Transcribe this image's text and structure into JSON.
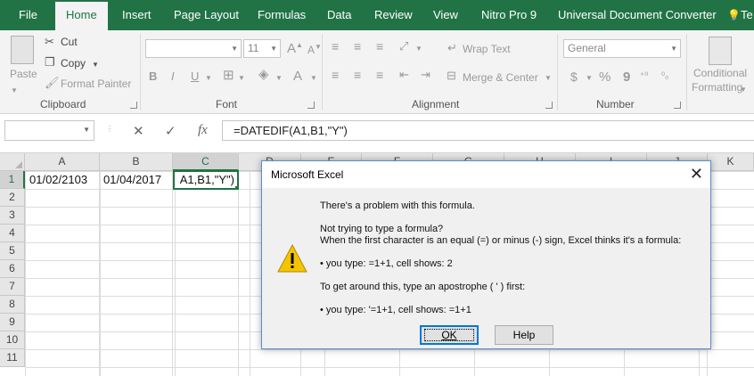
{
  "tabs": [
    "File",
    "Home",
    "Insert",
    "Page Layout",
    "Formulas",
    "Data",
    "Review",
    "View",
    "Nitro Pro 9",
    "Universal Document Converter",
    "Te"
  ],
  "ribbon": {
    "clipboard": {
      "paste": "Paste",
      "cut": "Cut",
      "copy": "Copy",
      "format_painter": "Format Painter",
      "label": "Clipboard"
    },
    "font": {
      "size": "11",
      "label": "Font",
      "bold": "B",
      "italic": "I",
      "underline": "U"
    },
    "alignment": {
      "wrap_text": "Wrap Text",
      "merge_center": "Merge & Center",
      "label": "Alignment"
    },
    "number": {
      "format": "General",
      "percent": "%",
      "comma": "9",
      "label": "Number"
    },
    "styles": {
      "conditional": "Conditional",
      "formatting": "Formatting"
    }
  },
  "formula_bar": {
    "cancel": "✕",
    "enter": "✓",
    "fx": "fx",
    "formula": "=DATEDIF(A1,B1,\"Y\")"
  },
  "columns": [
    "A",
    "B",
    "C",
    "D",
    "E",
    "F",
    "G",
    "H",
    "I",
    "J",
    "K"
  ],
  "rows": [
    "1",
    "2",
    "3",
    "4",
    "5",
    "6",
    "7",
    "8",
    "9",
    "10",
    "11"
  ],
  "cells": {
    "A1": "01/02/2103",
    "B1": "01/04/2017",
    "C1": "A1,B1,\"Y\")"
  },
  "dialog": {
    "title": "Microsoft Excel",
    "line1": "There's a problem with this formula.",
    "line2": "Not trying to type a formula?",
    "line3": "When the first character is an equal (=) or minus (-) sign, Excel thinks it's a formula:",
    "line4": "• you type:   =1+1, cell shows:   2",
    "line5": "To get around this, type an apostrophe ( ' ) first:",
    "line6": "• you type:   '=1+1, cell shows:   =1+1",
    "ok": "OK",
    "help": "Help"
  },
  "colors": {
    "excel_green": "#217346",
    "dialog_border": "#5d8dcf",
    "warning_yellow": "#f5c400"
  }
}
